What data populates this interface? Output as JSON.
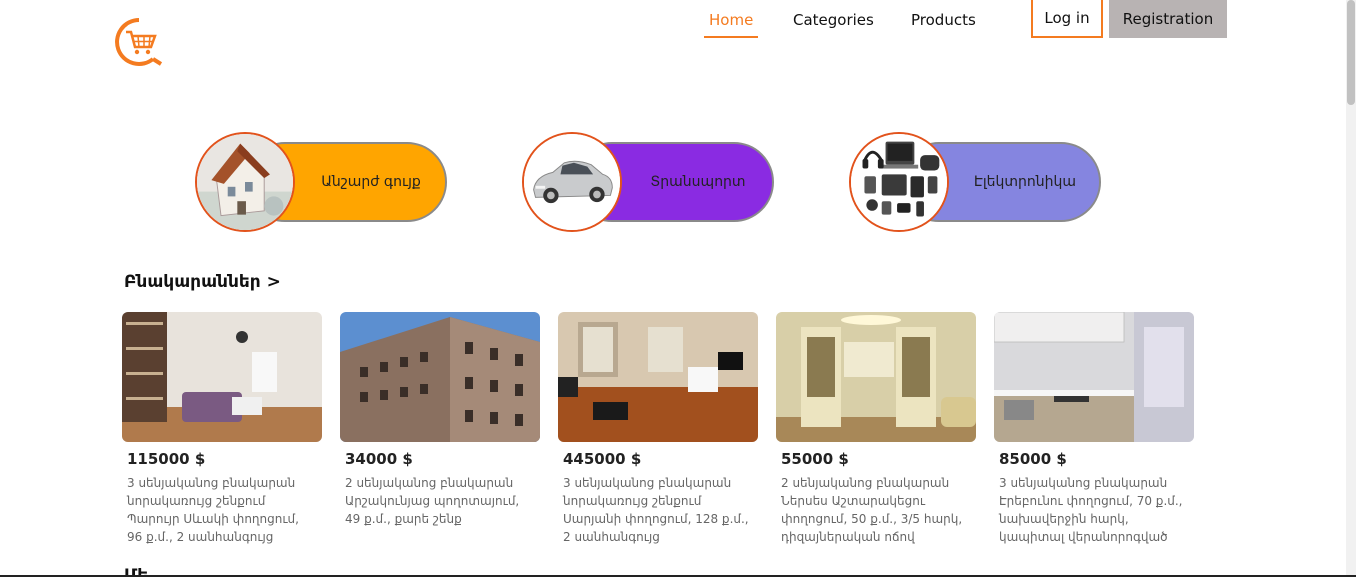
{
  "header": {
    "nav": [
      "Home",
      "Categories",
      "Products"
    ],
    "login_label": "Log in",
    "register_label": "Registration",
    "accent_color": "#f47b20"
  },
  "categories": [
    {
      "label": "Անշարժ գույք",
      "color": "#ffa500"
    },
    {
      "label": "Տրանսպորտ",
      "color": "#8a2be2"
    },
    {
      "label": "Էլեկտրոնիկա",
      "color": "#8585e0"
    }
  ],
  "section": {
    "title": "Բնակարաններ >",
    "next_title": "Մե"
  },
  "listings": [
    {
      "price": "115000 $",
      "desc": "3 սենյականոց բնակարան նորակառույց շենքում Պարույր Սևակի փողոցում, 96 ք.մ., 2 սանհանգույց"
    },
    {
      "price": "34000 $",
      "desc": "2 սենյականոց բնակարան Արշակունյաց պողոտայում, 49 ք.մ., քարե շենք"
    },
    {
      "price": "445000 $",
      "desc": "3 սենյականոց բնակարան նորակառույց շենքում Սարյանի փողոցում, 128 ք.մ., 2 սանհանգույց"
    },
    {
      "price": "55000 $",
      "desc": "2 սենյականոց բնակարան Ներսես Աշտարակեցու փողոցում, 50 ք.մ., 3/5 հարկ, դիզայներական ոճով"
    },
    {
      "price": "85000 $",
      "desc": "3 սենյականոց բնակարան Էրեբունու փողոցում, 70 ք.մ., նախավերջին հարկ, կապիտալ վերանորոգված"
    }
  ]
}
